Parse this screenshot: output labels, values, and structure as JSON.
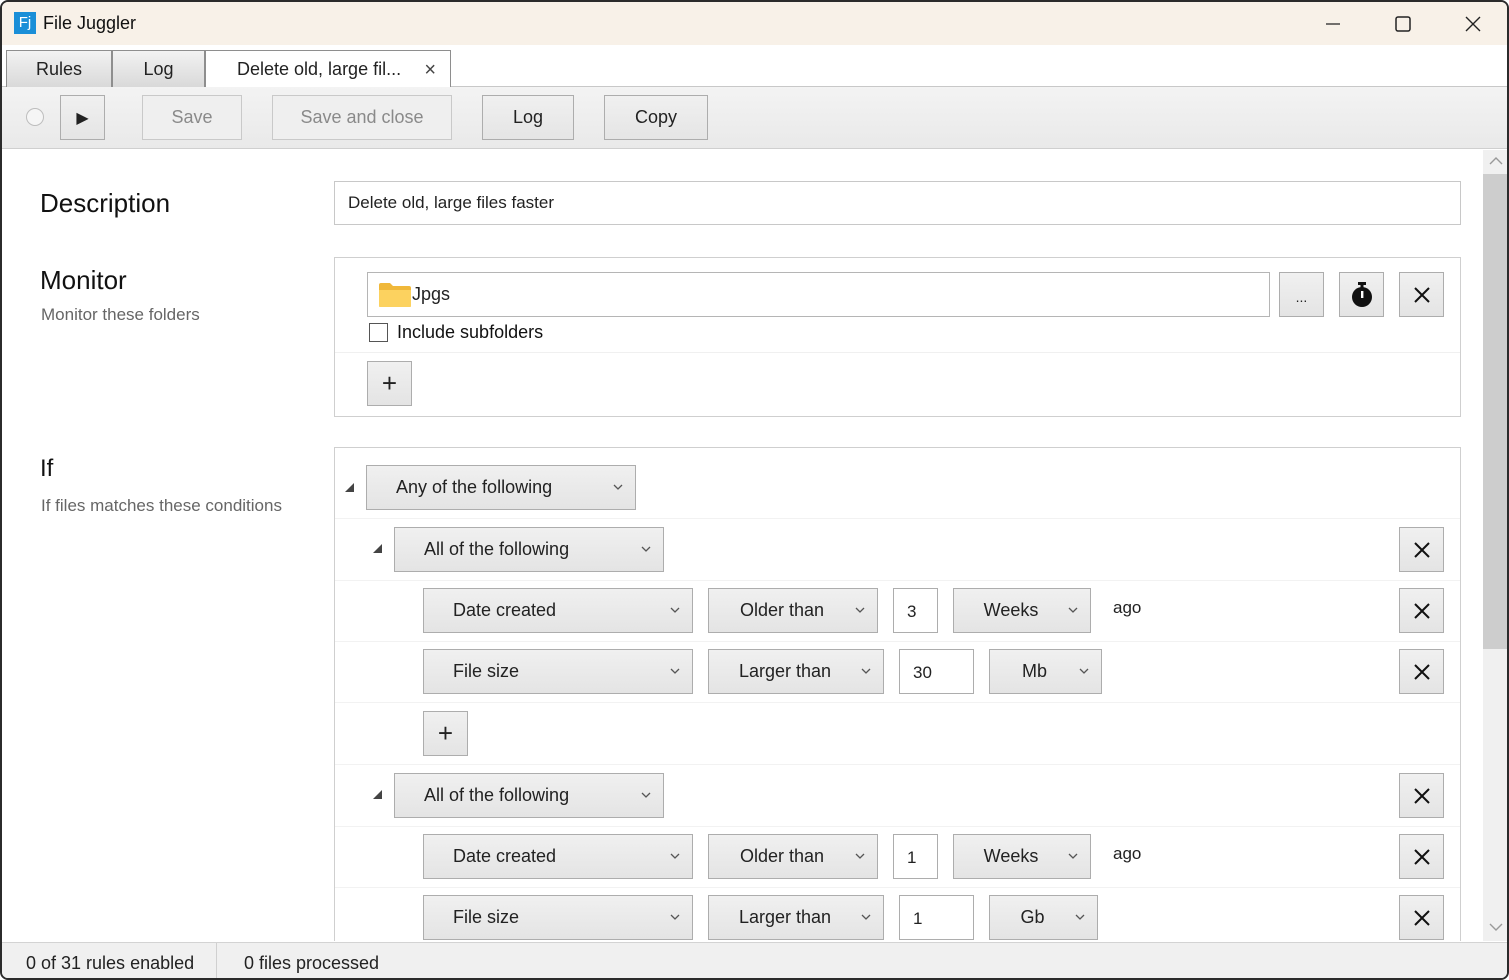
{
  "window": {
    "app_icon_text": "Fj",
    "title": "File Juggler"
  },
  "tabs": [
    {
      "label": "Rules"
    },
    {
      "label": "Log"
    },
    {
      "label": "Delete old, large fil...",
      "close_glyph": "×",
      "active": true
    }
  ],
  "toolbar": {
    "play_glyph": "▶",
    "save_label": "Save",
    "save_close_label": "Save and close",
    "log_label": "Log",
    "copy_label": "Copy"
  },
  "description": {
    "title": "Description",
    "value": "Delete old, large files faster"
  },
  "monitor": {
    "title": "Monitor",
    "subtitle": "Monitor these folders",
    "folders": [
      {
        "name": "Jpgs",
        "browse_label": "...",
        "include_subfolders": false
      }
    ],
    "include_subfolders_label": "Include subfolders",
    "add_glyph": "+"
  },
  "conditions": {
    "title": "If",
    "subtitle": "If files matches these conditions",
    "root_mode": "Any of the following",
    "groups": [
      {
        "mode": "All of the following",
        "rows": [
          {
            "field": "Date created",
            "op": "Older than",
            "value": "3",
            "unit": "Weeks",
            "suffix": "ago"
          },
          {
            "field": "File size",
            "op": "Larger than",
            "value": "30",
            "unit": "Mb",
            "suffix": ""
          }
        ],
        "add_glyph": "+"
      },
      {
        "mode": "All of the following",
        "rows": [
          {
            "field": "Date created",
            "op": "Older than",
            "value": "1",
            "unit": "Weeks",
            "suffix": "ago"
          },
          {
            "field": "File size",
            "op": "Larger than",
            "value": "1",
            "unit": "Gb",
            "suffix": ""
          }
        ]
      }
    ]
  },
  "status": {
    "rules": "0 of 31 rules enabled",
    "files": "0 files processed"
  },
  "colors": {
    "titlebar_bg": "#f8f1e8",
    "app_icon": "#1a8fd8",
    "folder_yellow": "#f5c242"
  }
}
